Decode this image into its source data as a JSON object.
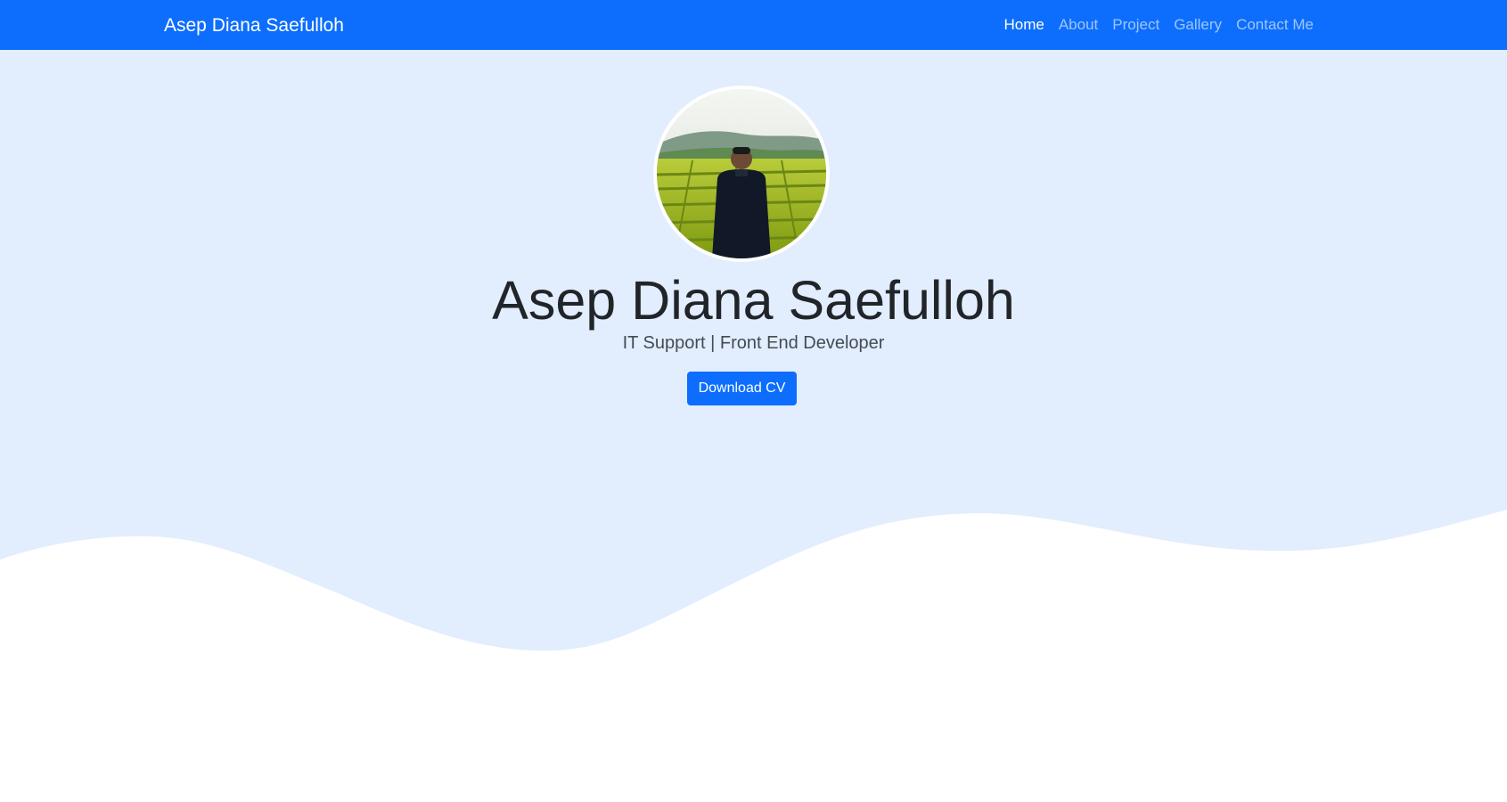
{
  "navbar": {
    "brand": "Asep Diana Saefulloh",
    "links": [
      {
        "label": "Home",
        "active": true
      },
      {
        "label": "About",
        "active": false
      },
      {
        "label": "Project",
        "active": false
      },
      {
        "label": "Gallery",
        "active": false
      },
      {
        "label": "Contact Me",
        "active": false
      }
    ]
  },
  "hero": {
    "avatar_icon": "profile-photo",
    "name": "Asep Diana Saefulloh",
    "subtitle": "IT Support | Front End Developer",
    "cta_label": "Download CV"
  },
  "colors": {
    "primary": "#0d6efd",
    "hero_background": "#e2edfe",
    "wave": "#ffffff"
  }
}
